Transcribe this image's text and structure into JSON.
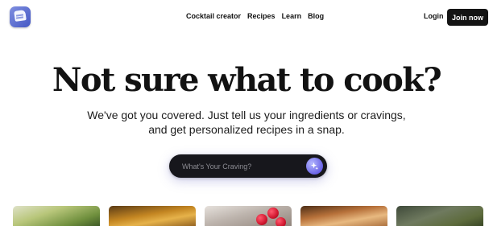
{
  "nav": {
    "links": [
      "Cocktail creator",
      "Recipes",
      "Learn",
      "Blog"
    ],
    "login_label": "Login",
    "join_label": "Join now"
  },
  "hero": {
    "headline": "Not sure what to cook?",
    "subtitle_line1": "We've got you covered. Just tell us your ingredients or cravings,",
    "subtitle_line2": "and get personalized recipes in a snap."
  },
  "search": {
    "placeholder": "What's Your Craving?",
    "button_icon": "sparkle-icon"
  },
  "colors": {
    "search_bg": "#17171c",
    "accent": "#6a63e6",
    "join_bg": "#141414"
  },
  "cards": [
    "recipe-image",
    "recipe-image",
    "recipe-image",
    "recipe-image",
    "recipe-image"
  ]
}
